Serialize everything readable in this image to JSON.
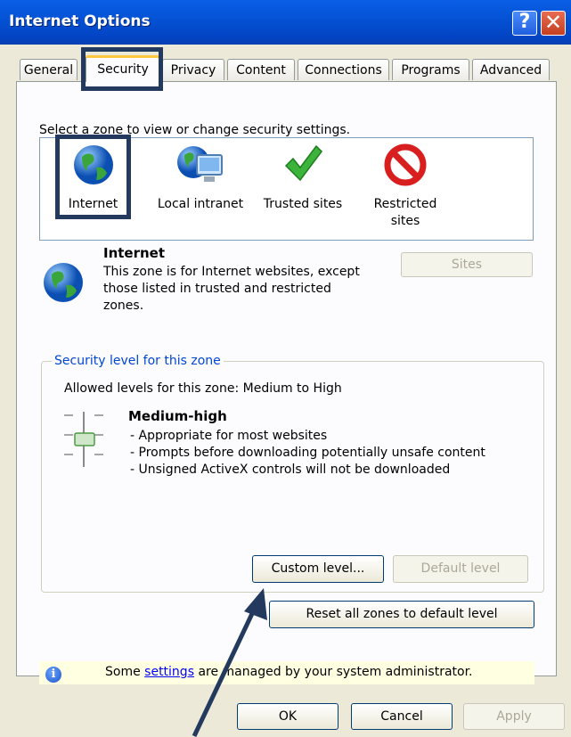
{
  "window": {
    "title": "Internet Options",
    "help_glyph": "?",
    "close_glyph": "✕"
  },
  "tabs": [
    {
      "label": "General"
    },
    {
      "label": "Security"
    },
    {
      "label": "Privacy"
    },
    {
      "label": "Content"
    },
    {
      "label": "Connections"
    },
    {
      "label": "Programs"
    },
    {
      "label": "Advanced"
    }
  ],
  "active_tab": "Security",
  "zones": {
    "prompt": "Select a zone to view or change security settings.",
    "items": [
      {
        "label": "Internet",
        "icon": "globe-icon",
        "selected": true
      },
      {
        "label": "Local intranet",
        "icon": "computer-globe-icon",
        "selected": false
      },
      {
        "label": "Trusted sites",
        "icon": "checkmark-icon",
        "selected": false
      },
      {
        "label": "Restricted sites",
        "icon": "no-entry-icon",
        "selected": false
      }
    ]
  },
  "zone_info": {
    "title": "Internet",
    "description": "This zone is for Internet websites, except those listed in trusted and restricted zones.",
    "sites_button": "Sites"
  },
  "security_level": {
    "group_label": "Security level for this zone",
    "allowed_levels": "Allowed levels for this zone: Medium to High",
    "level_name": "Medium-high",
    "bullets": [
      "- Appropriate for most websites",
      "- Prompts before downloading potentially unsafe content",
      "- Unsigned ActiveX controls will not be downloaded"
    ],
    "custom_level_button": "Custom level...",
    "default_level_button": "Default level"
  },
  "reset_button": "Reset all zones to default level",
  "notice": {
    "prefix": "Some ",
    "link": "settings",
    "suffix": " are managed by your system administrator."
  },
  "footer_buttons": {
    "ok": "OK",
    "cancel": "Cancel",
    "apply": "Apply"
  },
  "colors": {
    "titlebar": "#0553d6",
    "annotation": "#233a5e",
    "notice_bg": "#ffffe1"
  }
}
